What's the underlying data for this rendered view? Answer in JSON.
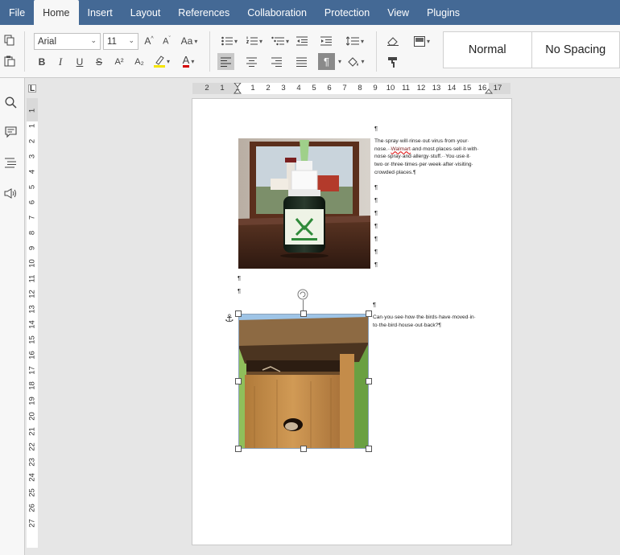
{
  "menu": {
    "items": [
      "File",
      "Home",
      "Insert",
      "Layout",
      "References",
      "Collaboration",
      "Protection",
      "View",
      "Plugins"
    ],
    "active": "Home"
  },
  "toolbar": {
    "font_name": "Arial",
    "font_size": "11",
    "change_case_label": "Aa",
    "bold_label": "B",
    "italic_label": "I",
    "underline_label": "U",
    "strike_label": "S",
    "superscript_label": "A²",
    "subscript_label": "A₂",
    "font_color_label": "A",
    "highlight_color": "#f5e400",
    "font_color": "#d40000"
  },
  "styles": {
    "items": [
      "Normal",
      "No Spacing"
    ]
  },
  "rulers": {
    "corner_label": "L",
    "horizontal": [
      "2",
      "1",
      "1",
      "1",
      "2",
      "3",
      "4",
      "5",
      "6",
      "7",
      "8",
      "9",
      "10",
      "11",
      "12",
      "13",
      "14",
      "15",
      "16",
      "17"
    ],
    "vertical": [
      "1",
      "1",
      "2",
      "3",
      "4",
      "5",
      "6",
      "7",
      "8",
      "9",
      "10",
      "11",
      "12",
      "13",
      "14",
      "15",
      "16",
      "17",
      "18",
      "19",
      "20",
      "21",
      "22",
      "23",
      "24",
      "25",
      "26",
      "27"
    ]
  },
  "document": {
    "pilcrow": "¶",
    "para1_line1": "The·spray·will·rinse·out·virus·from·your·",
    "para1_line2a": "nose.··",
    "para1_misspelled": "Walmart",
    "para1_line2b": "·and·most·places·sell·it·with·",
    "para1_line3": "nose·spray·and·allergy·stuff.··You·use·it·",
    "para1_line4": "two·or·three·times·per·week·after·visiting·",
    "para1_line5": "crowded·places.¶",
    "para2_line1": "Can·you·see·how·the·birds·have·moved·in·",
    "para2_line2": "to·the·bird·house·out·back?¶"
  },
  "colors": {
    "menubar": "#446995",
    "toolbar": "#f7f7f7",
    "canvas": "#e6e6e6"
  }
}
